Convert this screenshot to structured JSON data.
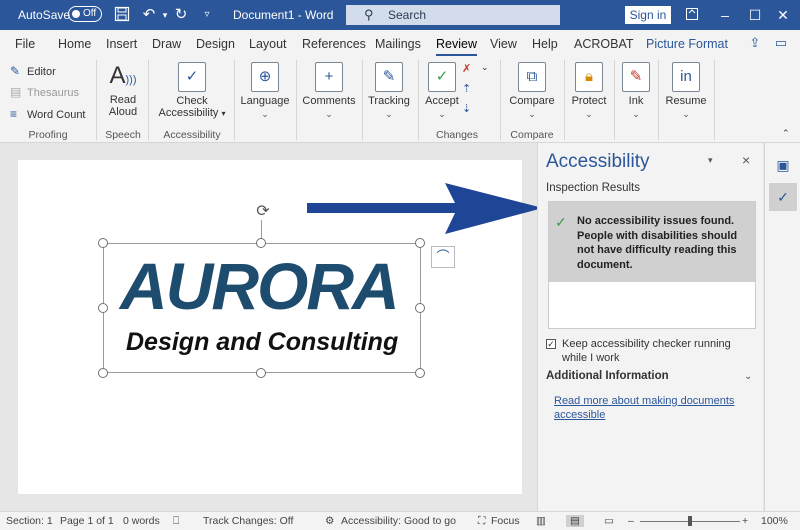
{
  "titlebar": {
    "autosave_label": "AutoSave",
    "autosave_state": "Off",
    "document_title": "Document1  -  Word",
    "search_placeholder": "Search",
    "signin_label": "Sign in",
    "icons": [
      "save-icon",
      "undo-icon",
      "redo-icon",
      "customize-qat-icon"
    ]
  },
  "tabs": [
    "File",
    "Home",
    "Insert",
    "Draw",
    "Design",
    "Layout",
    "References",
    "Mailings",
    "Review",
    "View",
    "Help",
    "ACROBAT",
    "Picture Format"
  ],
  "active_tab": "Review",
  "ribbon": {
    "proofing": {
      "editor": "Editor",
      "thesaurus": "Thesaurus",
      "word_count": "Word Count",
      "label": "Proofing"
    },
    "speech": {
      "read_aloud_1": "Read",
      "read_aloud_2": "Aloud",
      "label": "Speech"
    },
    "accessibility": {
      "check_1": "Check",
      "check_2": "Accessibility",
      "label": "Accessibility"
    },
    "language": {
      "label": "Language"
    },
    "comments": {
      "label": "Comments"
    },
    "tracking": {
      "label": "Tracking"
    },
    "changes": {
      "accept": "Accept",
      "label": "Changes"
    },
    "compare": {
      "button": "Compare",
      "label": "Compare"
    },
    "protect": {
      "label": "Protect"
    },
    "ink": {
      "label": "Ink"
    },
    "resume": {
      "label": "Resume"
    }
  },
  "document": {
    "logo_main": "AURORA",
    "logo_sub": "Design and Consulting"
  },
  "pane": {
    "title": "Accessibility",
    "inspection_results": "Inspection Results",
    "result_message": "No accessibility issues found. People with disabilities should not have difficulty reading this document.",
    "keep_running": "Keep accessibility checker running while I work",
    "keep_running_checked": true,
    "additional_info": "Additional Information",
    "read_more_link": "Read more about making documents accessible"
  },
  "statusbar": {
    "section": "Section: 1",
    "page": "Page 1 of 1",
    "words": "0 words",
    "track_changes": "Track Changes: Off",
    "accessibility": "Accessibility: Good to go",
    "focus": "Focus",
    "zoom": "100%",
    "zoom_level": 1.0
  },
  "colors": {
    "brand": "#2b579a",
    "logo": "#1d4c6e",
    "arrow": "#1f4596",
    "success": "#3a9b46"
  }
}
